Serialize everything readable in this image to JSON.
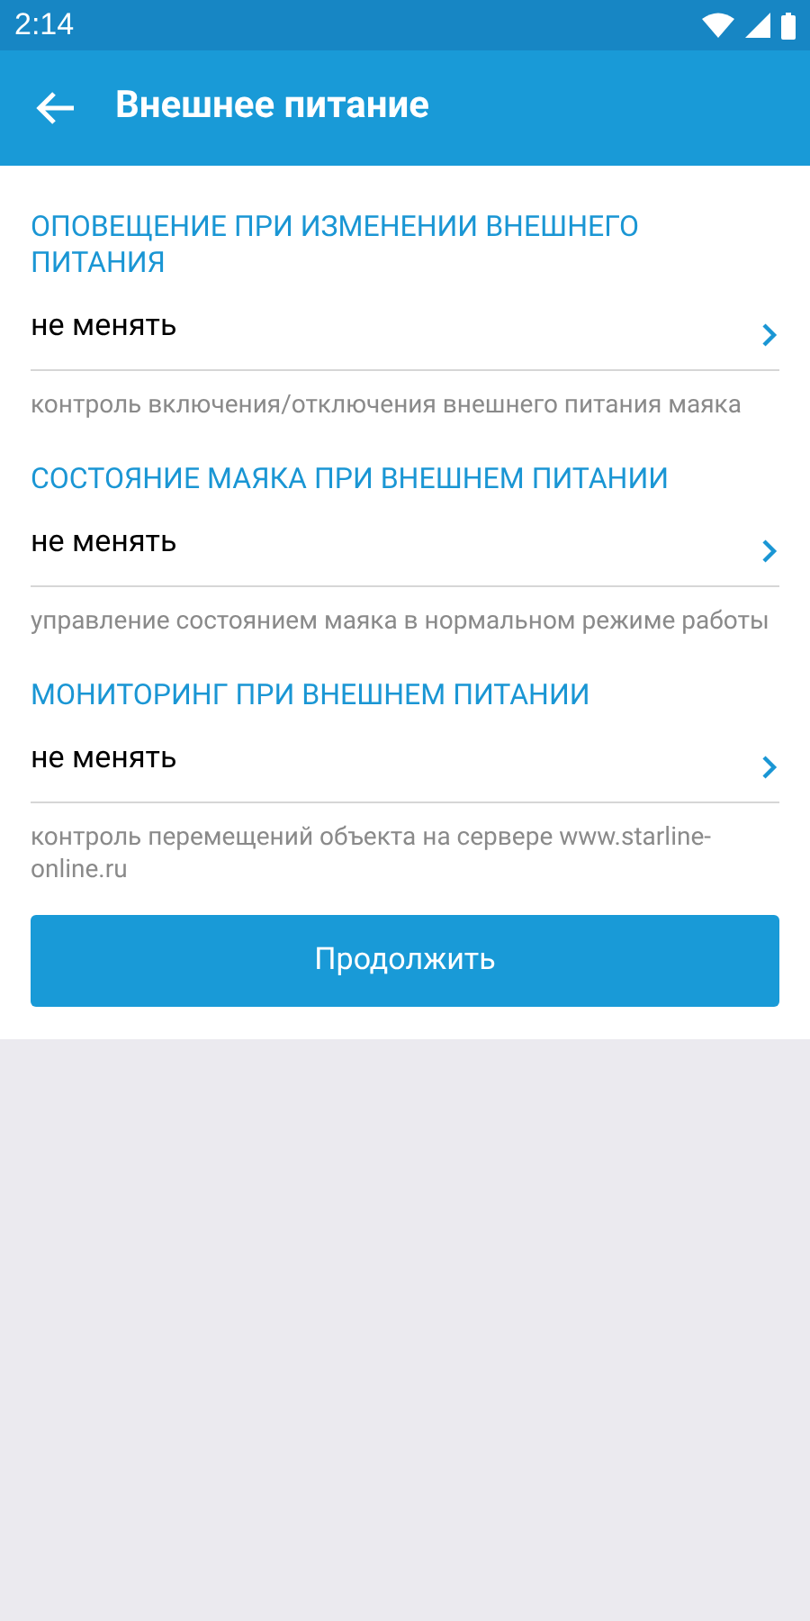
{
  "status_bar": {
    "time": "2:14"
  },
  "app_bar": {
    "title": "Внешнее питание"
  },
  "settings": [
    {
      "title": "ОПОВЕЩЕНИЕ ПРИ ИЗМЕНЕНИИ ВНЕШНЕГО ПИТАНИЯ",
      "value": "не менять",
      "hint": "контроль включения/отключения внешнего питания маяка"
    },
    {
      "title": "СОСТОЯНИЕ МАЯКА ПРИ ВНЕШНЕМ ПИТАНИИ",
      "value": "не менять",
      "hint": "управление состоянием маяка в нормальном режиме работы"
    },
    {
      "title": "МОНИТОРИНГ ПРИ ВНЕШНЕМ ПИТАНИИ",
      "value": "не менять",
      "hint": "контроль перемещений объекта на сервере www.starline-online.ru"
    }
  ],
  "button": {
    "label": "Продолжить"
  }
}
